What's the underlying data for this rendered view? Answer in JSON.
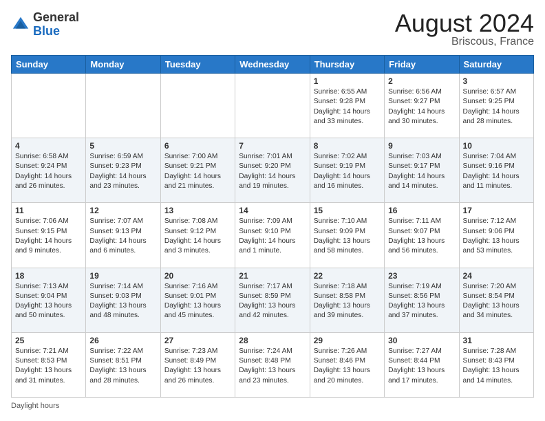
{
  "header": {
    "logo_general": "General",
    "logo_blue": "Blue",
    "month_year": "August 2024",
    "location": "Briscous, France"
  },
  "days_of_week": [
    "Sunday",
    "Monday",
    "Tuesday",
    "Wednesday",
    "Thursday",
    "Friday",
    "Saturday"
  ],
  "footer": {
    "daylight_hours": "Daylight hours"
  },
  "weeks": [
    [
      {
        "day": "",
        "info": ""
      },
      {
        "day": "",
        "info": ""
      },
      {
        "day": "",
        "info": ""
      },
      {
        "day": "",
        "info": ""
      },
      {
        "day": "1",
        "info": "Sunrise: 6:55 AM\nSunset: 9:28 PM\nDaylight: 14 hours\nand 33 minutes."
      },
      {
        "day": "2",
        "info": "Sunrise: 6:56 AM\nSunset: 9:27 PM\nDaylight: 14 hours\nand 30 minutes."
      },
      {
        "day": "3",
        "info": "Sunrise: 6:57 AM\nSunset: 9:25 PM\nDaylight: 14 hours\nand 28 minutes."
      }
    ],
    [
      {
        "day": "4",
        "info": "Sunrise: 6:58 AM\nSunset: 9:24 PM\nDaylight: 14 hours\nand 26 minutes."
      },
      {
        "day": "5",
        "info": "Sunrise: 6:59 AM\nSunset: 9:23 PM\nDaylight: 14 hours\nand 23 minutes."
      },
      {
        "day": "6",
        "info": "Sunrise: 7:00 AM\nSunset: 9:21 PM\nDaylight: 14 hours\nand 21 minutes."
      },
      {
        "day": "7",
        "info": "Sunrise: 7:01 AM\nSunset: 9:20 PM\nDaylight: 14 hours\nand 19 minutes."
      },
      {
        "day": "8",
        "info": "Sunrise: 7:02 AM\nSunset: 9:19 PM\nDaylight: 14 hours\nand 16 minutes."
      },
      {
        "day": "9",
        "info": "Sunrise: 7:03 AM\nSunset: 9:17 PM\nDaylight: 14 hours\nand 14 minutes."
      },
      {
        "day": "10",
        "info": "Sunrise: 7:04 AM\nSunset: 9:16 PM\nDaylight: 14 hours\nand 11 minutes."
      }
    ],
    [
      {
        "day": "11",
        "info": "Sunrise: 7:06 AM\nSunset: 9:15 PM\nDaylight: 14 hours\nand 9 minutes."
      },
      {
        "day": "12",
        "info": "Sunrise: 7:07 AM\nSunset: 9:13 PM\nDaylight: 14 hours\nand 6 minutes."
      },
      {
        "day": "13",
        "info": "Sunrise: 7:08 AM\nSunset: 9:12 PM\nDaylight: 14 hours\nand 3 minutes."
      },
      {
        "day": "14",
        "info": "Sunrise: 7:09 AM\nSunset: 9:10 PM\nDaylight: 14 hours\nand 1 minute."
      },
      {
        "day": "15",
        "info": "Sunrise: 7:10 AM\nSunset: 9:09 PM\nDaylight: 13 hours\nand 58 minutes."
      },
      {
        "day": "16",
        "info": "Sunrise: 7:11 AM\nSunset: 9:07 PM\nDaylight: 13 hours\nand 56 minutes."
      },
      {
        "day": "17",
        "info": "Sunrise: 7:12 AM\nSunset: 9:06 PM\nDaylight: 13 hours\nand 53 minutes."
      }
    ],
    [
      {
        "day": "18",
        "info": "Sunrise: 7:13 AM\nSunset: 9:04 PM\nDaylight: 13 hours\nand 50 minutes."
      },
      {
        "day": "19",
        "info": "Sunrise: 7:14 AM\nSunset: 9:03 PM\nDaylight: 13 hours\nand 48 minutes."
      },
      {
        "day": "20",
        "info": "Sunrise: 7:16 AM\nSunset: 9:01 PM\nDaylight: 13 hours\nand 45 minutes."
      },
      {
        "day": "21",
        "info": "Sunrise: 7:17 AM\nSunset: 8:59 PM\nDaylight: 13 hours\nand 42 minutes."
      },
      {
        "day": "22",
        "info": "Sunrise: 7:18 AM\nSunset: 8:58 PM\nDaylight: 13 hours\nand 39 minutes."
      },
      {
        "day": "23",
        "info": "Sunrise: 7:19 AM\nSunset: 8:56 PM\nDaylight: 13 hours\nand 37 minutes."
      },
      {
        "day": "24",
        "info": "Sunrise: 7:20 AM\nSunset: 8:54 PM\nDaylight: 13 hours\nand 34 minutes."
      }
    ],
    [
      {
        "day": "25",
        "info": "Sunrise: 7:21 AM\nSunset: 8:53 PM\nDaylight: 13 hours\nand 31 minutes."
      },
      {
        "day": "26",
        "info": "Sunrise: 7:22 AM\nSunset: 8:51 PM\nDaylight: 13 hours\nand 28 minutes."
      },
      {
        "day": "27",
        "info": "Sunrise: 7:23 AM\nSunset: 8:49 PM\nDaylight: 13 hours\nand 26 minutes."
      },
      {
        "day": "28",
        "info": "Sunrise: 7:24 AM\nSunset: 8:48 PM\nDaylight: 13 hours\nand 23 minutes."
      },
      {
        "day": "29",
        "info": "Sunrise: 7:26 AM\nSunset: 8:46 PM\nDaylight: 13 hours\nand 20 minutes."
      },
      {
        "day": "30",
        "info": "Sunrise: 7:27 AM\nSunset: 8:44 PM\nDaylight: 13 hours\nand 17 minutes."
      },
      {
        "day": "31",
        "info": "Sunrise: 7:28 AM\nSunset: 8:43 PM\nDaylight: 13 hours\nand 14 minutes."
      }
    ]
  ]
}
